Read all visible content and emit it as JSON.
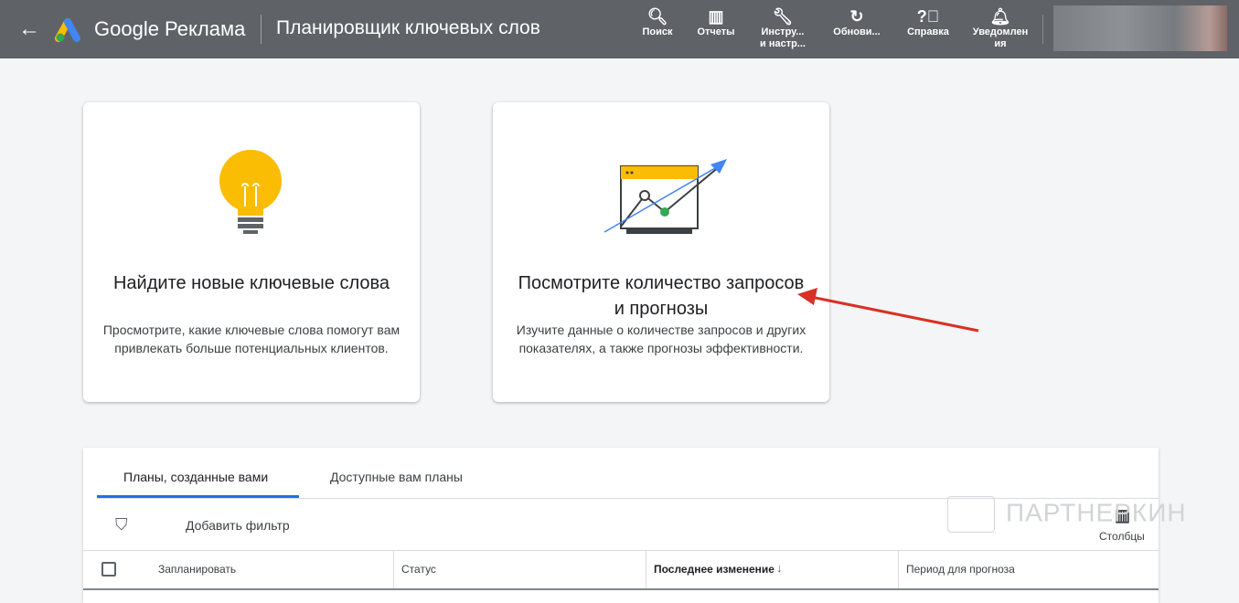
{
  "header": {
    "brand": "Google Реклама",
    "title": "Планировщик ключевых слов",
    "tools": [
      {
        "label": "Поиск",
        "icon": "search-icon"
      },
      {
        "label": "Отчеты",
        "icon": "reports-icon"
      },
      {
        "label": "Инстру...",
        "label2": "и настр...",
        "icon": "wrench-icon"
      },
      {
        "label": "Обнови...",
        "icon": "refresh-icon"
      },
      {
        "label": "Справка",
        "icon": "help-icon"
      },
      {
        "label": "Уведомлен",
        "label2": "ия",
        "icon": "bell-icon"
      }
    ]
  },
  "cards": [
    {
      "title": "Найдите новые ключевые слова",
      "desc": "Просмотрите, какие ключевые слова помогут вам привлекать больше потенциальных клиентов."
    },
    {
      "title": "Посмотрите количество запросов и прогнозы",
      "desc": "Изучите данные о количестве запросов и других показателях, а также прогнозы эффективности."
    }
  ],
  "plans": {
    "tabs": [
      "Планы, созданные вами",
      "Доступные вам планы"
    ],
    "filter": "Добавить фильтр",
    "columns_btn": "Столбцы",
    "headers": [
      "Запланировать",
      "Статус",
      "Последнее изменение",
      "Период для прогноза"
    ]
  },
  "watermark": "ПАРТНЕРКИН",
  "colors": {
    "header": "#5f6368",
    "accent": "#1a73e8",
    "arrow": "#d93025",
    "bulb": "#fbbc04"
  }
}
